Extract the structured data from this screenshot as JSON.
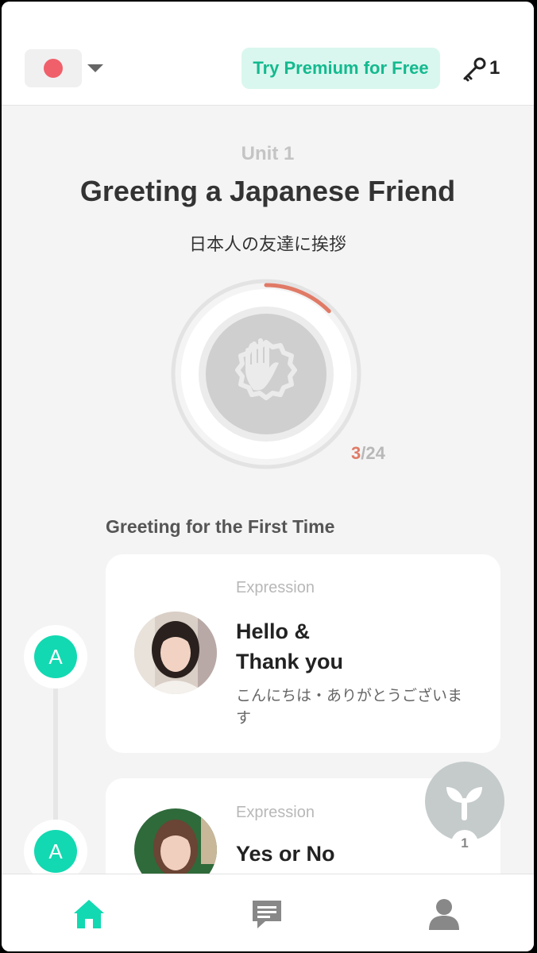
{
  "header": {
    "premium_label": "Try Premium for Free",
    "key_count": "1",
    "flag_color": "#f0606a"
  },
  "unit": {
    "label": "Unit 1",
    "title": "Greeting a Japanese Friend",
    "subtitle": "日本人の友達に挨拶",
    "progress_done": "3",
    "progress_total": "/24",
    "progress_fraction": 0.125,
    "icon": "waving-hand-icon"
  },
  "section": {
    "title": "Greeting for the First Time"
  },
  "lessons": [
    {
      "node_label": "A",
      "type": "Expression",
      "title": "Hello &\nThank you",
      "subtitle": "こんにちは・ありがとうございます"
    },
    {
      "node_label": "A",
      "type": "Expression",
      "title": "Yes or No",
      "subtitle": ""
    }
  ],
  "fab": {
    "icon": "sprout-icon",
    "badge": "1"
  },
  "nav": {
    "items": [
      "home-icon",
      "chat-icon",
      "profile-icon"
    ],
    "active_color": "#12d9b1",
    "inactive_color": "#888888"
  },
  "colors": {
    "accent": "#12d9b1",
    "progress": "#e07a66"
  }
}
